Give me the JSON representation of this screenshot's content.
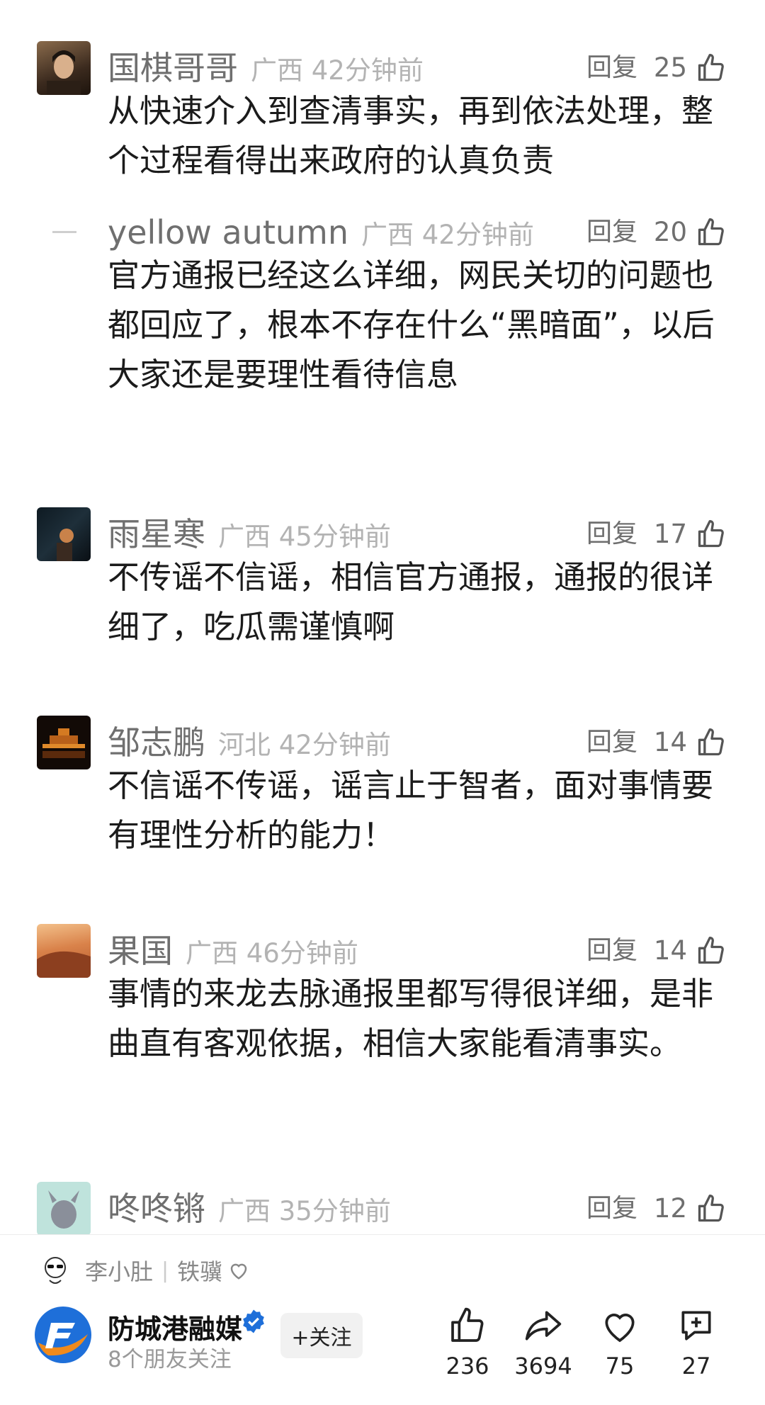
{
  "comments": [
    {
      "user": "国棋哥哥",
      "location": "广西",
      "time": "42分钟前",
      "reply_label": "回复",
      "likes": "25",
      "text": "从快速介入到查清事实，再到依法处理，整个过程看得出来政府的认真负责"
    },
    {
      "user": "yellow autumn",
      "location": "广西",
      "time": "42分钟前",
      "reply_label": "回复",
      "likes": "20",
      "text": "官方通报已经这么详细，网民关切的问题也都回应了，根本不存在什么“黑暗面”，以后大家还是要理性看待信息"
    },
    {
      "user": "雨星寒",
      "location": "广西",
      "time": "45分钟前",
      "reply_label": "回复",
      "likes": "17",
      "text": "不传谣不信谣，相信官方通报，通报的很详细了，吃瓜需谨慎啊"
    },
    {
      "user": "邹志鹏",
      "location": "河北",
      "time": "42分钟前",
      "reply_label": "回复",
      "likes": "14",
      "text": "不信谣不传谣，谣言止于智者，面对事情要有理性分析的能力！"
    },
    {
      "user": "果国",
      "location": "广西",
      "time": "46分钟前",
      "reply_label": "回复",
      "likes": "14",
      "text": "事情的来龙去脉通报里都写得很详细，是非曲直有客观依据，相信大家能看清事实。"
    },
    {
      "user": "咚咚锵",
      "location": "广西",
      "time": "35分钟前",
      "reply_label": "回复",
      "likes": "12",
      "text": ""
    }
  ],
  "friend_row": {
    "name": "李小肚",
    "tag": "铁骥"
  },
  "account": {
    "name": "防城港融媒",
    "subtitle": "8个朋友关注",
    "follow_label": "+关注"
  },
  "actions": {
    "like_count": "236",
    "share_count": "3694",
    "favorite_count": "75",
    "comment_count": "27"
  },
  "colors": {
    "accent_blue": "#1e6fd9",
    "logo_orange": "#f08a1c",
    "text_gray": "#6f6f6f"
  },
  "icons": [
    "thumb-up-icon",
    "share-arrow-icon",
    "heart-icon",
    "comment-plus-icon",
    "verified-icon"
  ]
}
